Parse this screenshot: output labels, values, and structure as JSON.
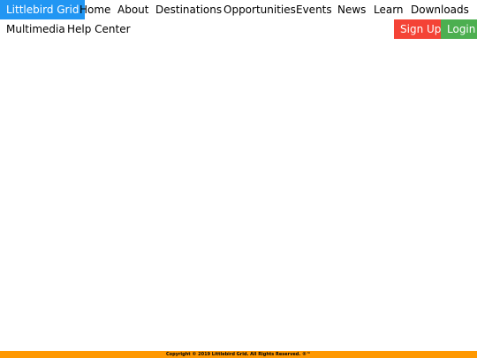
{
  "navbar": {
    "brand": "Littlebird Grid",
    "links": [
      "Home",
      "About",
      "Destinations",
      "Opportunities",
      "Events",
      "News",
      "Learn",
      "Downloads",
      "Multimedia",
      "Help Center"
    ],
    "signup_label": "Sign Up",
    "login_label": "Login"
  },
  "footer": {
    "copyright": "Copyright © 2019 Littlebird Grid. All Rights Reserved. ®™"
  },
  "colors": {
    "brand_bg": "#2196f3",
    "signup_bg": "#f44336",
    "login_bg": "#4caf50",
    "footer_bg": "#ff9800"
  }
}
